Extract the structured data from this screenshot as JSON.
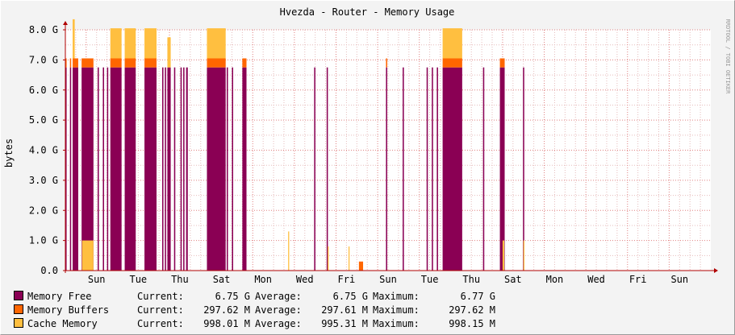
{
  "chart_data": {
    "type": "area",
    "title": "Hvezda - Router - Memory Usage",
    "ylabel": "bytes",
    "watermark": "RRDTOOL / TOBI OETIKER",
    "ylim": [
      0,
      8.0
    ],
    "y_ticks": [
      "0.0",
      "1.0 G",
      "2.0 G",
      "3.0 G",
      "4.0 G",
      "5.0 G",
      "6.0 G",
      "7.0 G",
      "8.0 G"
    ],
    "y_tick_values": [
      0,
      1,
      2,
      3,
      4,
      5,
      6,
      7,
      8
    ],
    "y_unit": "G bytes",
    "x_day_labels": [
      "Sun",
      "Tue",
      "Thu",
      "Sat",
      "Mon",
      "Wed",
      "Fri",
      "Sun",
      "Tue",
      "Thu",
      "Sat",
      "Mon",
      "Wed",
      "Fri",
      "Sun"
    ],
    "xlim_days": [
      0,
      31
    ],
    "grid": true,
    "colors": {
      "background": "#f3f3f3",
      "plot": "#ffffff",
      "grid_minor": "#e6bcbc",
      "grid_major": "#e08080",
      "axis": "#b00000",
      "memory_free": "#8a0054",
      "memory_buffers": "#ff6600",
      "cache_memory": "#ffbf40"
    },
    "series": [
      {
        "name": "Memory Free",
        "color": "#8a0054",
        "segments": [
          [
            0.0,
            0.06,
            6.75
          ],
          [
            0.22,
            0.28,
            6.75
          ],
          [
            0.35,
            0.62,
            6.75
          ],
          [
            0.78,
            1.35,
            6.75
          ],
          [
            1.55,
            1.61,
            6.75
          ],
          [
            1.8,
            1.86,
            6.75
          ],
          [
            2.0,
            2.06,
            6.75
          ],
          [
            2.16,
            2.7,
            6.75
          ],
          [
            2.85,
            3.38,
            6.75
          ],
          [
            3.8,
            4.38,
            6.75
          ],
          [
            4.65,
            4.71,
            6.75
          ],
          [
            4.78,
            4.84,
            6.75
          ],
          [
            4.9,
            5.06,
            6.75
          ],
          [
            5.22,
            5.28,
            6.75
          ],
          [
            5.53,
            5.59,
            6.75
          ],
          [
            5.66,
            5.72,
            6.75
          ],
          [
            5.8,
            5.88,
            6.75
          ],
          [
            6.8,
            7.7,
            6.75
          ],
          [
            7.75,
            7.81,
            6.75
          ],
          [
            8.0,
            8.06,
            6.75
          ],
          [
            8.5,
            8.7,
            6.75
          ],
          [
            11.95,
            12.01,
            6.75
          ],
          [
            12.55,
            12.61,
            6.75
          ],
          [
            15.4,
            15.46,
            6.75
          ],
          [
            16.2,
            16.26,
            6.75
          ],
          [
            17.35,
            17.41,
            6.75
          ],
          [
            17.6,
            17.66,
            6.75
          ],
          [
            17.84,
            17.9,
            6.75
          ],
          [
            18.12,
            19.06,
            6.75
          ],
          [
            20.06,
            20.12,
            6.75
          ],
          [
            20.87,
            21.1,
            6.75
          ],
          [
            21.98,
            22.04,
            6.75
          ]
        ]
      },
      {
        "name": "Memory Buffers",
        "color": "#ff6600",
        "segments": [
          [
            0.0,
            0.06,
            0.3
          ],
          [
            0.22,
            0.28,
            0.3
          ],
          [
            0.35,
            0.62,
            0.3
          ],
          [
            0.78,
            1.35,
            0.3
          ],
          [
            2.16,
            2.7,
            0.3
          ],
          [
            2.85,
            3.38,
            0.3
          ],
          [
            3.8,
            4.38,
            0.3
          ],
          [
            6.8,
            7.7,
            0.3
          ],
          [
            8.5,
            8.7,
            0.3
          ],
          [
            14.1,
            14.3,
            0.3
          ],
          [
            15.4,
            15.46,
            0.3
          ],
          [
            18.12,
            19.06,
            0.3
          ],
          [
            20.87,
            21.1,
            0.3
          ]
        ]
      },
      {
        "name": "Cache Memory",
        "color": "#ffbf40",
        "segments": [
          [
            0.35,
            0.45,
            1.3
          ],
          [
            0.8,
            1.35,
            1.0
          ],
          [
            2.16,
            2.7,
            1.0
          ],
          [
            2.85,
            3.38,
            1.0
          ],
          [
            3.8,
            4.38,
            1.0
          ],
          [
            4.9,
            5.06,
            1.0
          ],
          [
            6.8,
            7.7,
            1.0
          ],
          [
            10.7,
            10.75,
            1.3
          ],
          [
            12.6,
            12.65,
            0.8
          ],
          [
            13.6,
            13.65,
            0.8
          ],
          [
            18.12,
            19.06,
            1.0
          ],
          [
            21.0,
            21.08,
            1.0
          ],
          [
            22.0,
            22.05,
            1.0
          ]
        ]
      }
    ],
    "legend": [
      {
        "name": "Memory Free",
        "color": "#8a0054",
        "current_label": "Current:",
        "current": "6.75 G",
        "average_label": "Average:",
        "average": "6.75 G",
        "maximum_label": "Maximum:",
        "maximum": "6.77 G"
      },
      {
        "name": "Memory Buffers",
        "color": "#ff6600",
        "current_label": "Current:",
        "current": "297.62 M",
        "average_label": "Average:",
        "average": "297.61 M",
        "maximum_label": "Maximum:",
        "maximum": "297.62 M"
      },
      {
        "name": "Cache Memory",
        "color": "#ffbf40",
        "current_label": "Current:",
        "current": "998.01 M",
        "average_label": "Average:",
        "average": "995.31 M",
        "maximum_label": "Maximum:",
        "maximum": "998.15 M"
      }
    ]
  }
}
